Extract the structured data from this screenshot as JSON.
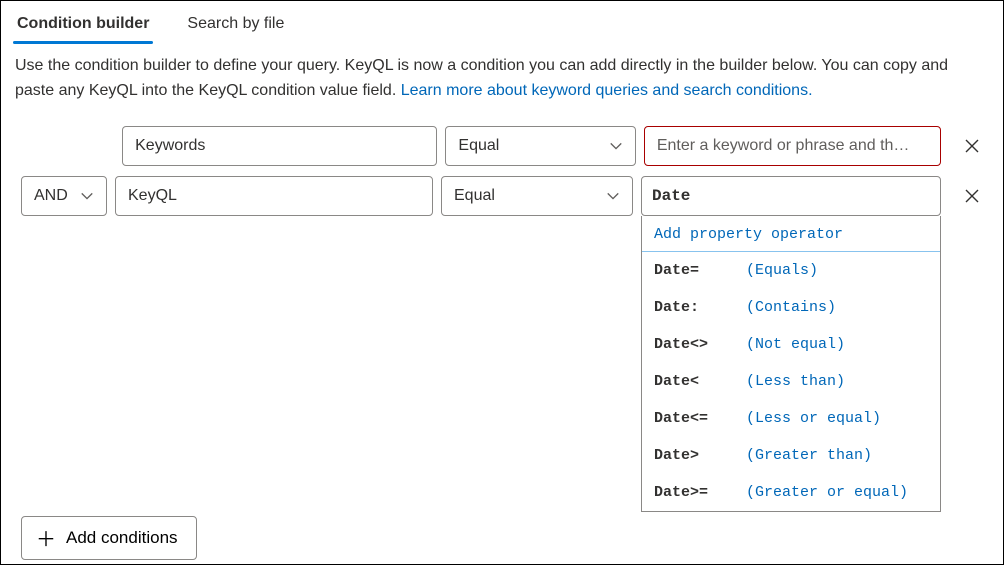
{
  "tabs": {
    "builder": "Condition builder",
    "searchByFile": "Search by file"
  },
  "description": {
    "text": "Use the condition builder to define your query. KeyQL is now a condition you can add directly in the builder below. You can copy and paste any KeyQL into the KeyQL condition value field. ",
    "link": "Learn more about keyword queries and search conditions."
  },
  "row1": {
    "property": "Keywords",
    "operator": "Equal",
    "placeholder": "Enter a keyword or phrase and th…"
  },
  "row2": {
    "logic": "AND",
    "property": "KeyQL",
    "operator": "Equal",
    "value": "Date"
  },
  "suggest": {
    "header": "Add property operator",
    "items": [
      {
        "op": "Date=",
        "desc": "(Equals)"
      },
      {
        "op": "Date:",
        "desc": "(Contains)"
      },
      {
        "op": "Date<>",
        "desc": "(Not equal)"
      },
      {
        "op": "Date<",
        "desc": "(Less than)"
      },
      {
        "op": "Date<=",
        "desc": "(Less or equal)"
      },
      {
        "op": "Date>",
        "desc": "(Greater than)"
      },
      {
        "op": "Date>=",
        "desc": "(Greater or equal)"
      }
    ]
  },
  "addButton": "Add conditions"
}
